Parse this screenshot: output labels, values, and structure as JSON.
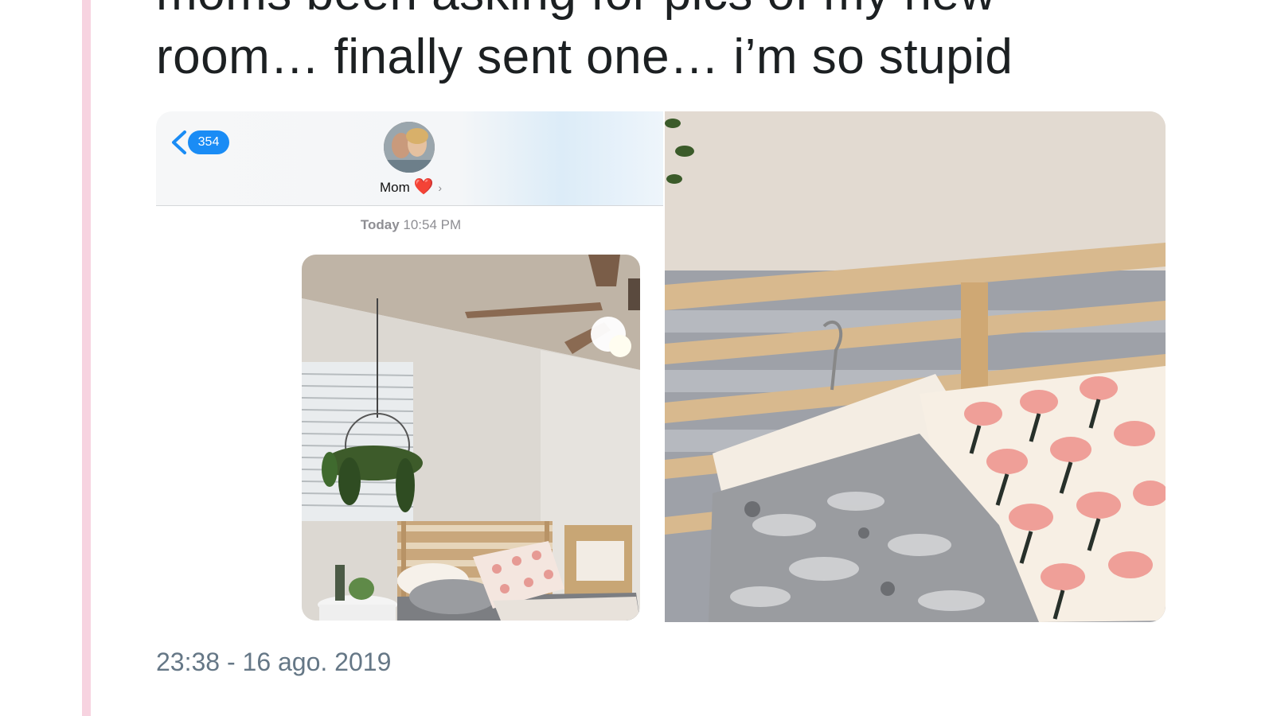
{
  "tweet": {
    "line1": "moms been asking for pics of my new",
    "line2": "room… finally sent one… i’m so stupid",
    "timestamp": "23:38 - 16 ago. 2019"
  },
  "imessage": {
    "back_badge": "354",
    "contact_name": "Mom",
    "contact_heart": "❤️",
    "contact_chevron": "›",
    "time_day": "Today",
    "time_clock": "10:54 PM"
  },
  "colors": {
    "rail": "#f7d3e0",
    "imessage_blue": "#1a8cf5",
    "timestamp": "#657786"
  }
}
